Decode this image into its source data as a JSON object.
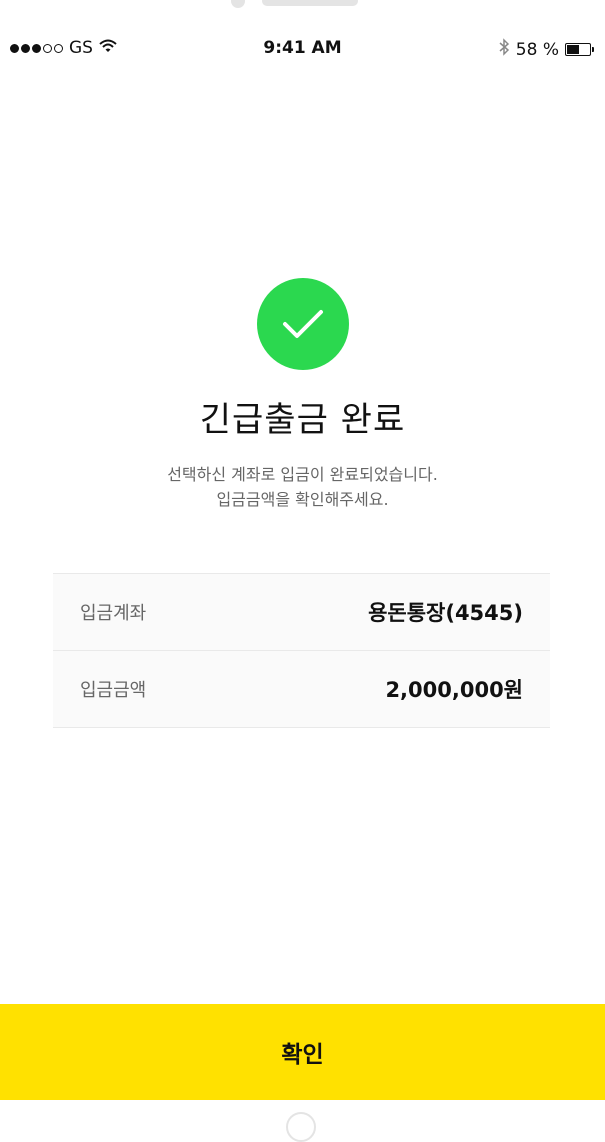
{
  "status_bar": {
    "carrier": "GS",
    "time": "9:41 AM",
    "battery_text": "58 %",
    "battery_level": 0.58,
    "icons": [
      "signal-dots-icon",
      "wifi-icon",
      "bluetooth-icon",
      "battery-icon"
    ]
  },
  "result": {
    "icon": "check-icon",
    "icon_color": "#2bd84f",
    "title": "긴급출금 완료",
    "subtitle_line1": "선택하신 계좌로 입금이 완료되었습니다.",
    "subtitle_line2": "입금금액을 확인해주세요."
  },
  "details": [
    {
      "label": "입금계좌",
      "value": "용돈통장(4545)"
    },
    {
      "label": "입금금액",
      "value": "2,000,000원"
    }
  ],
  "footer": {
    "confirm_label": "확인",
    "button_color": "#ffe100"
  }
}
